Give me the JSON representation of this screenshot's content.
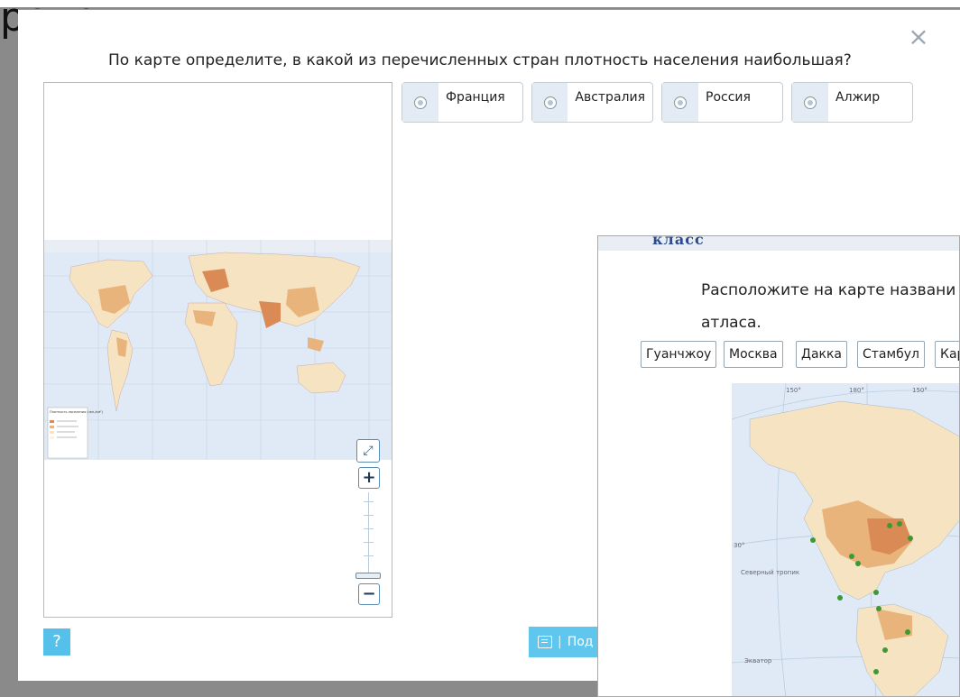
{
  "background": {
    "partial_word": "роке:"
  },
  "task1": {
    "question": "По карте определите, в какой из перечисленных стран плотность населения наибольшая?",
    "close_symbol": "×",
    "options": [
      {
        "label": "Франция"
      },
      {
        "label": "Австралия"
      },
      {
        "label": "Россия"
      },
      {
        "label": "Алжир"
      }
    ],
    "map": {
      "legend_title": "Плотность населения (чел./км²)",
      "fullscreen_symbol": "⤢",
      "zoom_in": "+",
      "zoom_out": "−"
    },
    "help_label": "?",
    "submit_label": "Под"
  },
  "task2": {
    "header_word": "класс",
    "question_line1": "Расположите на карте названи",
    "question_line2": "атласа.",
    "chips": [
      "Гуанчжоу",
      "Москва",
      "Дакка",
      "Стамбул",
      "Кар"
    ],
    "map_labels": {
      "tropic": "Северный тропик",
      "equator": "Экватор",
      "deg_30": "30°",
      "deg_150": "150°",
      "deg_180": "180°"
    }
  },
  "colors": {
    "ocean": "#dfeaf6",
    "land_light": "#f6e3c2",
    "land_mid": "#e9b47c",
    "land_dark": "#d98a55",
    "accent": "#5fc6ee",
    "city_dot": "#3c9a34"
  }
}
